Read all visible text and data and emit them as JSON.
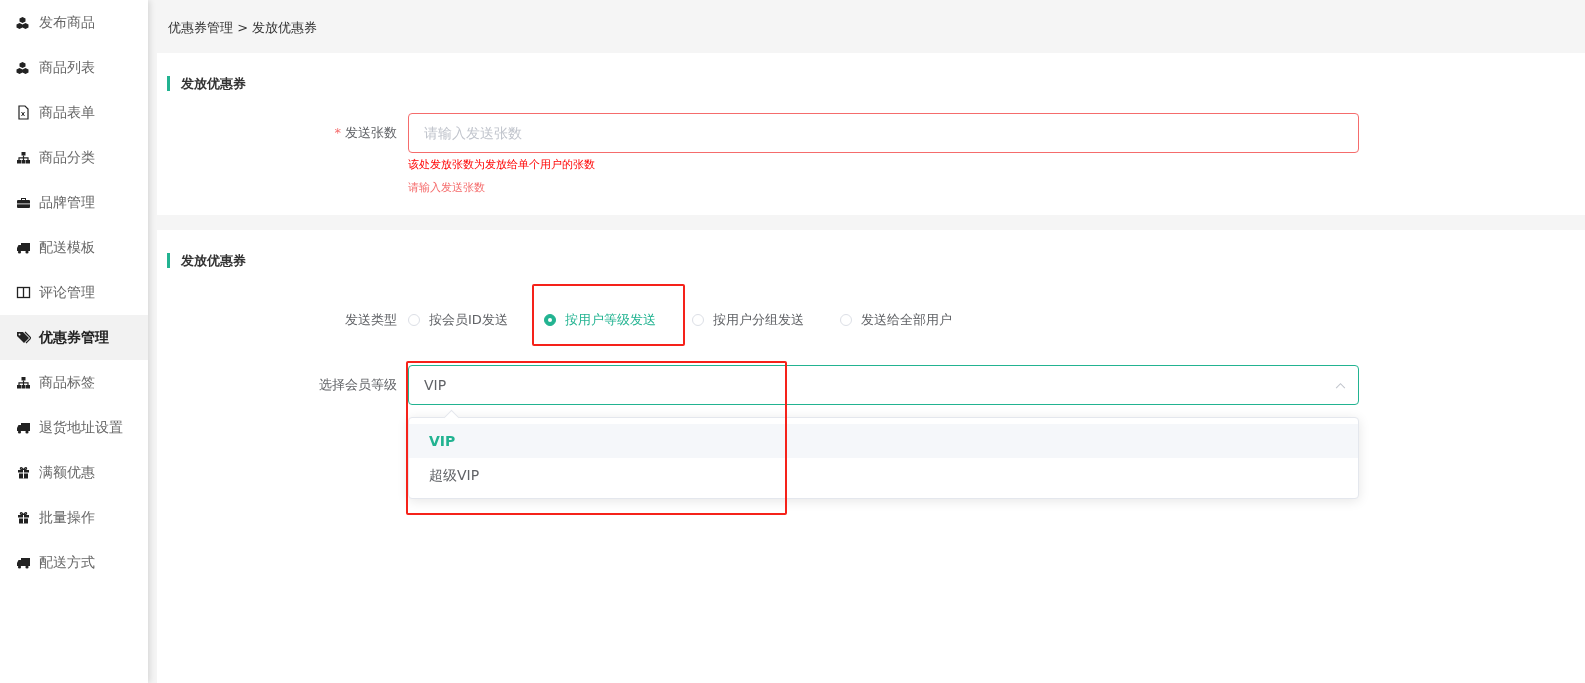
{
  "sidebar": {
    "items": [
      {
        "label": "发布商品",
        "kind": "cubes",
        "selected": false
      },
      {
        "label": "商品列表",
        "kind": "cubes",
        "selected": false
      },
      {
        "label": "商品表单",
        "kind": "file",
        "selected": false
      },
      {
        "label": "商品分类",
        "kind": "sitemap",
        "selected": false
      },
      {
        "label": "品牌管理",
        "kind": "briefcase",
        "selected": false
      },
      {
        "label": "配送模板",
        "kind": "truck",
        "selected": false
      },
      {
        "label": "评论管理",
        "kind": "columns",
        "selected": false
      },
      {
        "label": "优惠券管理",
        "kind": "tags",
        "selected": true
      },
      {
        "label": "商品标签",
        "kind": "sitemap",
        "selected": false
      },
      {
        "label": "退货地址设置",
        "kind": "truck",
        "selected": false
      },
      {
        "label": "满额优惠",
        "kind": "gift",
        "selected": false
      },
      {
        "label": "批量操作",
        "kind": "gift",
        "selected": false
      },
      {
        "label": "配送方式",
        "kind": "truck",
        "selected": false
      }
    ]
  },
  "breadcrumb": "优惠券管理 > 发放优惠券",
  "card_1": {
    "title": "发放优惠券",
    "field": {
      "required_mark": "*",
      "label": "发送张数",
      "placeholder": "请输入发送张数",
      "invalid": true,
      "hint": "该处发放张数为发放给单个用户的张数",
      "error": "请输入发送张数"
    }
  },
  "card_2": {
    "title": "发放优惠券",
    "send_type": {
      "label": "发送类型",
      "options": [
        {
          "label": "按会员ID发送",
          "selected": false,
          "highlighted": false
        },
        {
          "label": "按用户等级发送",
          "selected": true,
          "highlighted": true
        },
        {
          "label": "按用户分组发送",
          "selected": false,
          "highlighted": false
        },
        {
          "label": "发送给全部用户",
          "selected": false,
          "highlighted": false
        }
      ]
    },
    "member_level": {
      "label": "选择会员等级",
      "value": "VIP",
      "expanded": true,
      "highlighted": true,
      "options": [
        {
          "label": "VIP",
          "selected": true
        },
        {
          "label": "超级VIP",
          "selected": false
        }
      ]
    }
  }
}
